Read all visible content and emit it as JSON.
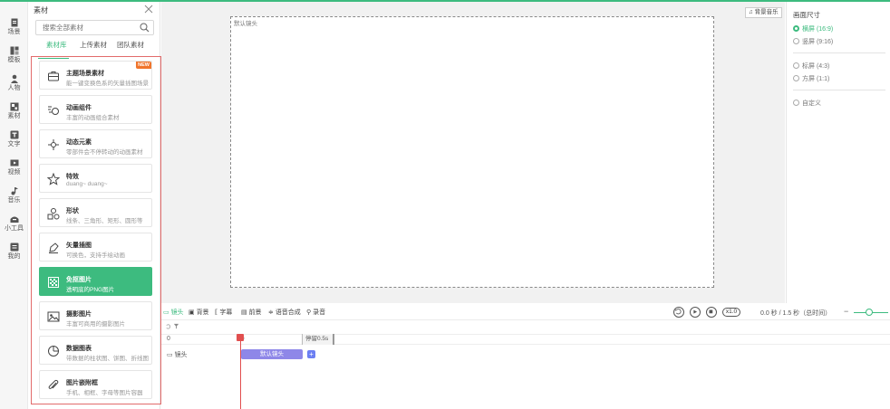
{
  "nav": [
    {
      "label": "场景",
      "icon": "scene-icon"
    },
    {
      "label": "模板",
      "icon": "template-icon"
    },
    {
      "label": "人物",
      "icon": "person-icon"
    },
    {
      "label": "素材",
      "icon": "material-icon"
    },
    {
      "label": "文字",
      "icon": "text-icon"
    },
    {
      "label": "视频",
      "icon": "video-icon"
    },
    {
      "label": "音乐",
      "icon": "music-icon"
    },
    {
      "label": "小工具",
      "icon": "tools-icon"
    },
    {
      "label": "我的",
      "icon": "mine-icon"
    }
  ],
  "panel": {
    "title": "素材",
    "search_placeholder": "搜索全部素材",
    "tabs": [
      "素材库",
      "上传素材",
      "团队素材"
    ],
    "cards": [
      {
        "title": "主题场景素材",
        "desc": "能一键变换色系的矢量插图场景",
        "icon": "bag-icon",
        "badge": "NEW"
      },
      {
        "title": "动画组件",
        "desc": "丰富的动画组合素材",
        "icon": "animation-icon"
      },
      {
        "title": "动态元素",
        "desc": "零部件会不停转动的动画素材",
        "icon": "dynamic-icon"
      },
      {
        "title": "特效",
        "desc": "duang~ duang~",
        "icon": "effect-icon"
      },
      {
        "title": "形状",
        "desc": "线条、三角形、矩形、圆形等",
        "icon": "shape-icon"
      },
      {
        "title": "矢量插图",
        "desc": "可换色，支持手绘动画",
        "icon": "vector-icon"
      },
      {
        "title": "免抠图片",
        "desc": "透明底的PNG图片",
        "icon": "png-icon",
        "active": true
      },
      {
        "title": "摄影图片",
        "desc": "丰富可商用的摄影图片",
        "icon": "photo-icon"
      },
      {
        "title": "数据图表",
        "desc": "带数据的柱状图、饼图、折线图",
        "icon": "chart-icon"
      },
      {
        "title": "图片嵌附框",
        "desc": "手机、相框、字母等图片容器",
        "icon": "clip-icon"
      }
    ]
  },
  "canvas": {
    "label": "默认镜头"
  },
  "bgm_button": "♫ 背景音乐",
  "settings": {
    "title": "画面尺寸",
    "options": [
      {
        "label": "横屏 (16:9)",
        "selected": true
      },
      {
        "label": "竖屏 (9:16)"
      },
      {
        "label": "标屏 (4:3)"
      },
      {
        "label": "方屏 (1:1)"
      },
      {
        "label": "自定义"
      }
    ]
  },
  "toolbar": {
    "items": [
      "镜头",
      "背景",
      "字幕",
      "前景",
      "语音合成",
      "录音"
    ],
    "speed": "x1.0",
    "time": "0.0 秒 / 1.5 秒（总时间）"
  },
  "timeline": {
    "ruler_label": "0",
    "ruler_mark": "0",
    "stay_label": "停留0.5s",
    "track_label": "镜头",
    "clip_label": "默认镜头",
    "add_label": "+"
  },
  "colors": {
    "accent": "#3dbb7f",
    "highlight_frame": "#e26b6b",
    "clip": "#8e87e8",
    "playhead": "#e14f4f"
  }
}
